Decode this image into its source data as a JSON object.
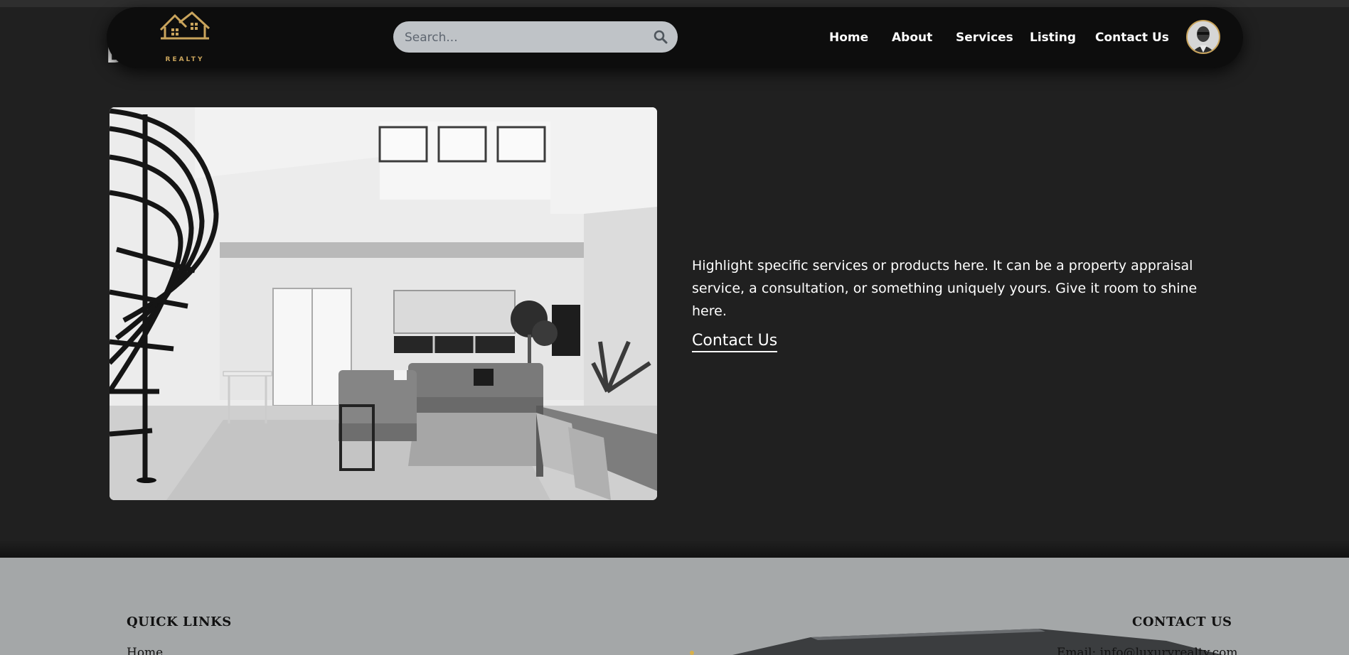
{
  "brand": {
    "logo_text": "REALTY",
    "stray_heading_char": "D",
    "accent_color": "#c9a45c"
  },
  "search": {
    "placeholder": "Search...",
    "icon": "search-icon"
  },
  "nav": {
    "items": [
      {
        "label": "Home"
      },
      {
        "label": "About"
      },
      {
        "label": "Services"
      },
      {
        "label": "Listing"
      },
      {
        "label": "Contact Us"
      }
    ],
    "avatar_icon": "user-avatar"
  },
  "feature": {
    "image_alt": "living-room-photo",
    "description": "Highlight specific services or products here. It can be a property appraisal service, a consultation, or something uniquely yours. Give it room to shine here.",
    "cta_label": "Contact Us"
  },
  "footer": {
    "quick_links_heading": "QUICK LINKS",
    "first_link": "Home",
    "contact_heading": "CONTACT US",
    "email_line": "Email: info@luxuryrealty.com"
  },
  "colors": {
    "background": "#202020",
    "navbar": "#0d0d0d",
    "search_bg": "#bfc3c7",
    "footer_bg": "#a1a4a5"
  }
}
